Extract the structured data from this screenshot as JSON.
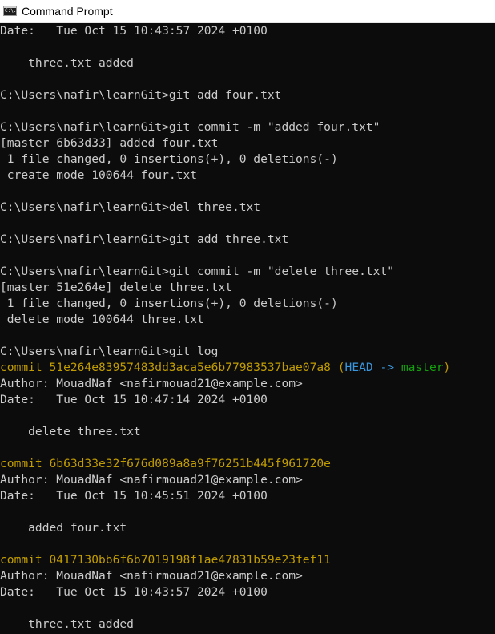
{
  "window": {
    "title": "Command Prompt",
    "icon": "cmd-icon",
    "icon_text": "C:\\."
  },
  "colors": {
    "background": "#0c0c0c",
    "text": "#cccccc",
    "commit_hash": "#c19c00",
    "head": "#3a96dd",
    "branch": "#13a10e"
  },
  "console": {
    "lines": [
      [
        {
          "text": "Date:   Tue Oct 15 10:43:57 2024 +0100"
        }
      ],
      [
        {
          "text": ""
        }
      ],
      [
        {
          "text": "    three.txt added"
        }
      ],
      [
        {
          "text": ""
        }
      ],
      [
        {
          "text": "C:\\Users\\nafir\\learnGit>git add four.txt"
        }
      ],
      [
        {
          "text": ""
        }
      ],
      [
        {
          "text": "C:\\Users\\nafir\\learnGit>git commit -m \"added four.txt\""
        }
      ],
      [
        {
          "text": "[master 6b63d33] added four.txt"
        }
      ],
      [
        {
          "text": " 1 file changed, 0 insertions(+), 0 deletions(-)"
        }
      ],
      [
        {
          "text": " create mode 100644 four.txt"
        }
      ],
      [
        {
          "text": ""
        }
      ],
      [
        {
          "text": "C:\\Users\\nafir\\learnGit>del three.txt"
        }
      ],
      [
        {
          "text": ""
        }
      ],
      [
        {
          "text": "C:\\Users\\nafir\\learnGit>git add three.txt"
        }
      ],
      [
        {
          "text": ""
        }
      ],
      [
        {
          "text": "C:\\Users\\nafir\\learnGit>git commit -m \"delete three.txt\""
        }
      ],
      [
        {
          "text": "[master 51e264e] delete three.txt"
        }
      ],
      [
        {
          "text": " 1 file changed, 0 insertions(+), 0 deletions(-)"
        }
      ],
      [
        {
          "text": " delete mode 100644 three.txt"
        }
      ],
      [
        {
          "text": ""
        }
      ],
      [
        {
          "text": "C:\\Users\\nafir\\learnGit>git log"
        }
      ],
      [
        {
          "text": "commit 51e264e83957483dd3aca5e6b77983537bae07a8 (",
          "color": "yellow"
        },
        {
          "text": "HEAD -> ",
          "color": "cyan"
        },
        {
          "text": "master",
          "color": "green"
        },
        {
          "text": ")",
          "color": "yellow"
        }
      ],
      [
        {
          "text": "Author: MouadNaf <nafirmouad21@example.com>"
        }
      ],
      [
        {
          "text": "Date:   Tue Oct 15 10:47:14 2024 +0100"
        }
      ],
      [
        {
          "text": ""
        }
      ],
      [
        {
          "text": "    delete three.txt"
        }
      ],
      [
        {
          "text": ""
        }
      ],
      [
        {
          "text": "commit 6b63d33e32f676d089a8a9f76251b445f961720e",
          "color": "yellow"
        }
      ],
      [
        {
          "text": "Author: MouadNaf <nafirmouad21@example.com>"
        }
      ],
      [
        {
          "text": "Date:   Tue Oct 15 10:45:51 2024 +0100"
        }
      ],
      [
        {
          "text": ""
        }
      ],
      [
        {
          "text": "    added four.txt"
        }
      ],
      [
        {
          "text": ""
        }
      ],
      [
        {
          "text": "commit 0417130bb6f6b7019198f1ae47831b59e23fef11",
          "color": "yellow"
        }
      ],
      [
        {
          "text": "Author: MouadNaf <nafirmouad21@example.com>"
        }
      ],
      [
        {
          "text": "Date:   Tue Oct 15 10:43:57 2024 +0100"
        }
      ],
      [
        {
          "text": ""
        }
      ],
      [
        {
          "text": "    three.txt added"
        }
      ]
    ]
  }
}
